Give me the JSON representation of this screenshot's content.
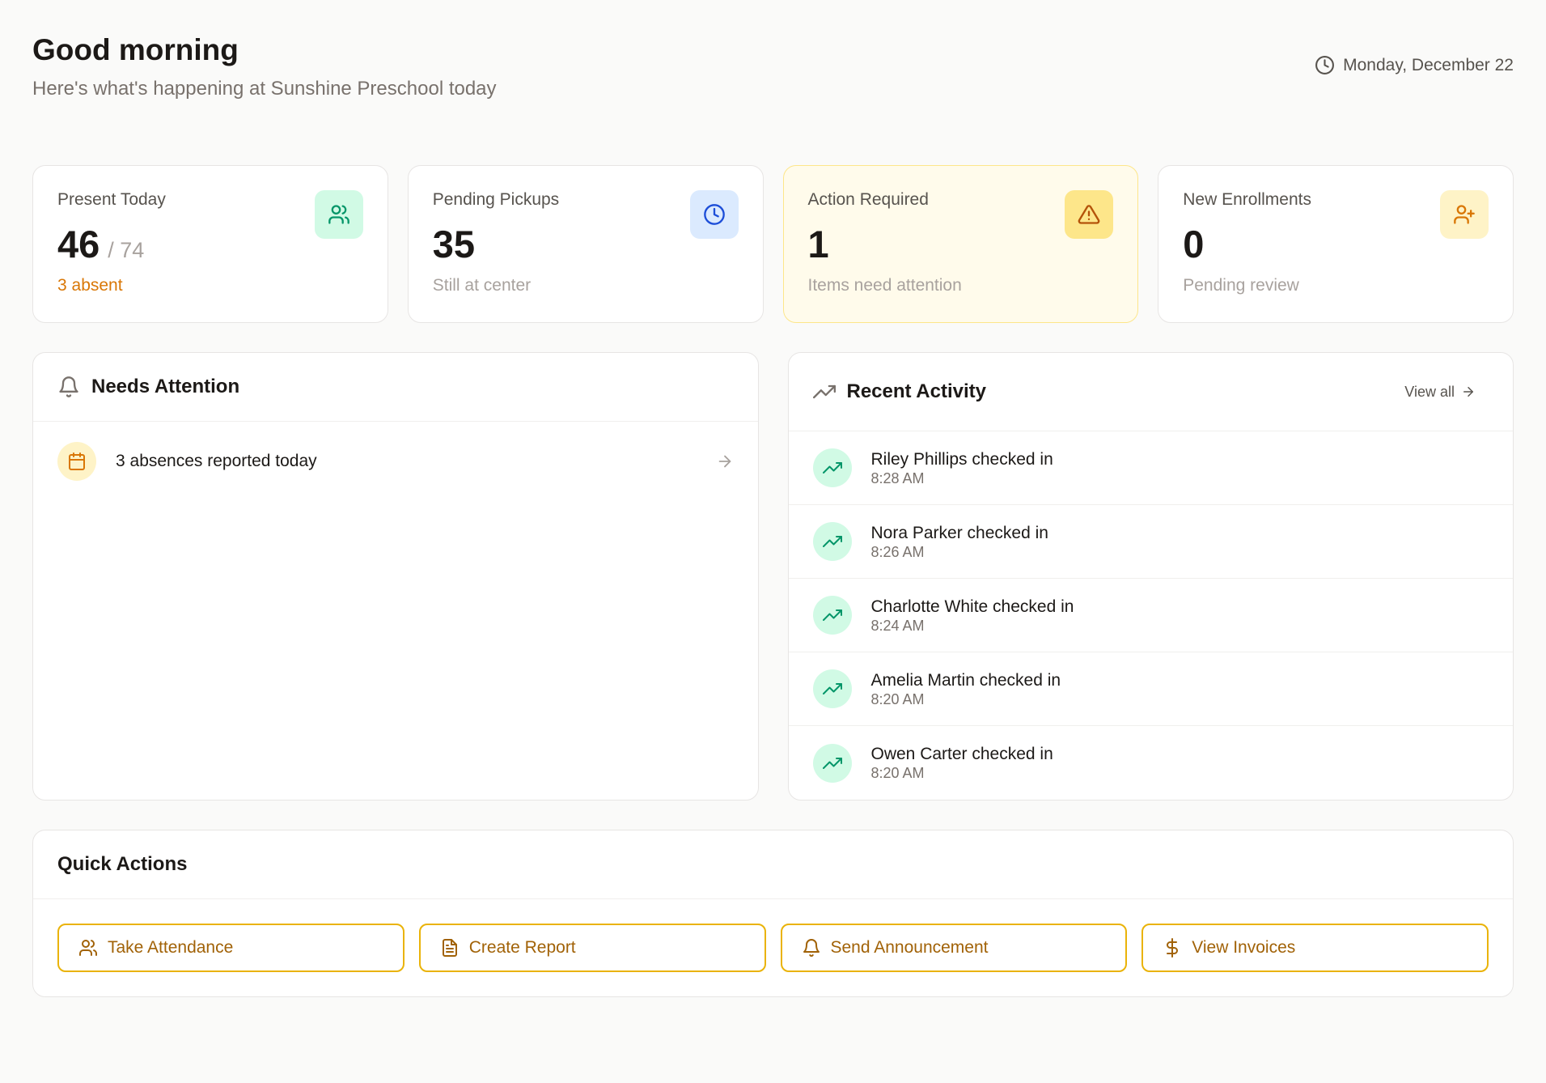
{
  "header": {
    "greeting": "Good morning",
    "subtitle": "Here's what's happening at Sunshine Preschool today",
    "date": "Monday, December 22",
    "date_icon": "clock-icon"
  },
  "stats": [
    {
      "label": "Present Today",
      "value": "46",
      "total": "/ 74",
      "sub": "3 absent",
      "icon": "users-icon"
    },
    {
      "label": "Pending Pickups",
      "value": "35",
      "sub": "Still at center",
      "icon": "clock-icon"
    },
    {
      "label": "Action Required",
      "value": "1",
      "sub": "Items need attention",
      "icon": "alert-triangle-icon"
    },
    {
      "label": "New Enrollments",
      "value": "0",
      "sub": "Pending review",
      "icon": "user-plus-icon"
    }
  ],
  "attention": {
    "title": "Needs Attention",
    "items": [
      {
        "text": "3 absences reported today",
        "icon": "calendar-icon"
      }
    ]
  },
  "activity": {
    "title": "Recent Activity",
    "view_all": "View all",
    "items": [
      {
        "text": "Riley Phillips checked in",
        "time": "8:28 AM"
      },
      {
        "text": "Nora Parker checked in",
        "time": "8:26 AM"
      },
      {
        "text": "Charlotte White checked in",
        "time": "8:24 AM"
      },
      {
        "text": "Amelia Martin checked in",
        "time": "8:20 AM"
      },
      {
        "text": "Owen Carter checked in",
        "time": "8:20 AM"
      }
    ]
  },
  "quick_actions": {
    "title": "Quick Actions",
    "buttons": [
      {
        "label": "Take Attendance",
        "icon": "users-icon"
      },
      {
        "label": "Create Report",
        "icon": "file-text-icon"
      },
      {
        "label": "Send Announcement",
        "icon": "bell-icon"
      },
      {
        "label": "View Invoices",
        "icon": "dollar-icon"
      }
    ]
  },
  "colors": {
    "background": "#fafaf9",
    "accent": "#eab308",
    "accent_text": "#a16207",
    "absent_text": "#d97706",
    "success": "#059669"
  }
}
